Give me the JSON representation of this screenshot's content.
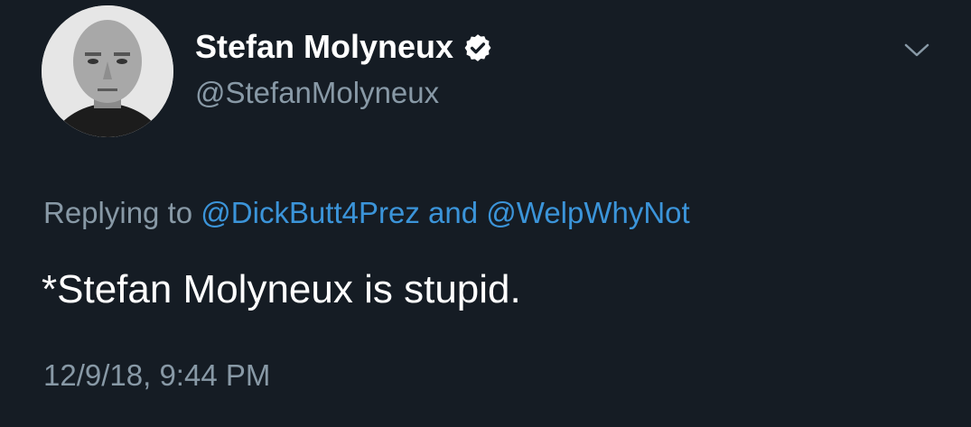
{
  "tweet": {
    "author": {
      "display_name": "Stefan Molyneux",
      "handle": "@StefanMolyneux",
      "verified": true
    },
    "reply": {
      "prefix": "Replying to",
      "mention_1": "@DickButt4Prez",
      "conjunction": "and",
      "mention_2": "@WelpWhyNot"
    },
    "text": "*Stefan Molyneux is stupid.",
    "timestamp": "12/9/18, 9:44 PM"
  },
  "colors": {
    "background": "#151c24",
    "secondary_text": "#8899a6",
    "link": "#3b94d9",
    "primary_text": "#ffffff"
  },
  "icons": {
    "verified": "verified-badge-icon",
    "menu": "chevron-down-icon"
  }
}
